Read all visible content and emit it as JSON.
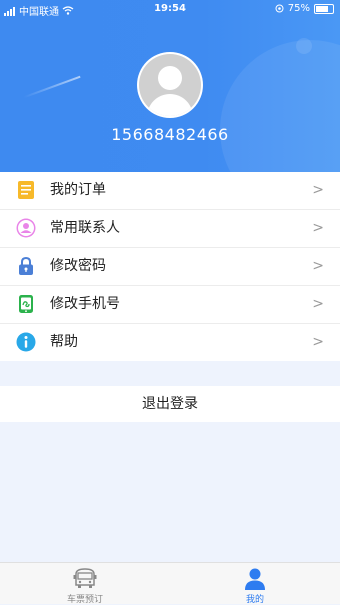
{
  "status_bar": {
    "carrier": "中国联通",
    "time": "19:54",
    "battery": "75%"
  },
  "profile": {
    "phone": "15668482466"
  },
  "menu": [
    {
      "label": "我的订单",
      "icon": "order-icon"
    },
    {
      "label": "常用联系人",
      "icon": "contact-icon"
    },
    {
      "label": "修改密码",
      "icon": "lock-icon"
    },
    {
      "label": "修改手机号",
      "icon": "phone-icon"
    },
    {
      "label": "帮助",
      "icon": "info-icon"
    }
  ],
  "logout_label": "退出登录",
  "tabbar": {
    "tabs": [
      {
        "label": "车票预订",
        "icon": "bus-icon",
        "active": false
      },
      {
        "label": "我的",
        "icon": "person-icon",
        "active": true
      }
    ]
  },
  "colors": {
    "brand": "#3e8af0",
    "active_tab": "#2e7cf0",
    "inactive_tab": "#888888"
  }
}
